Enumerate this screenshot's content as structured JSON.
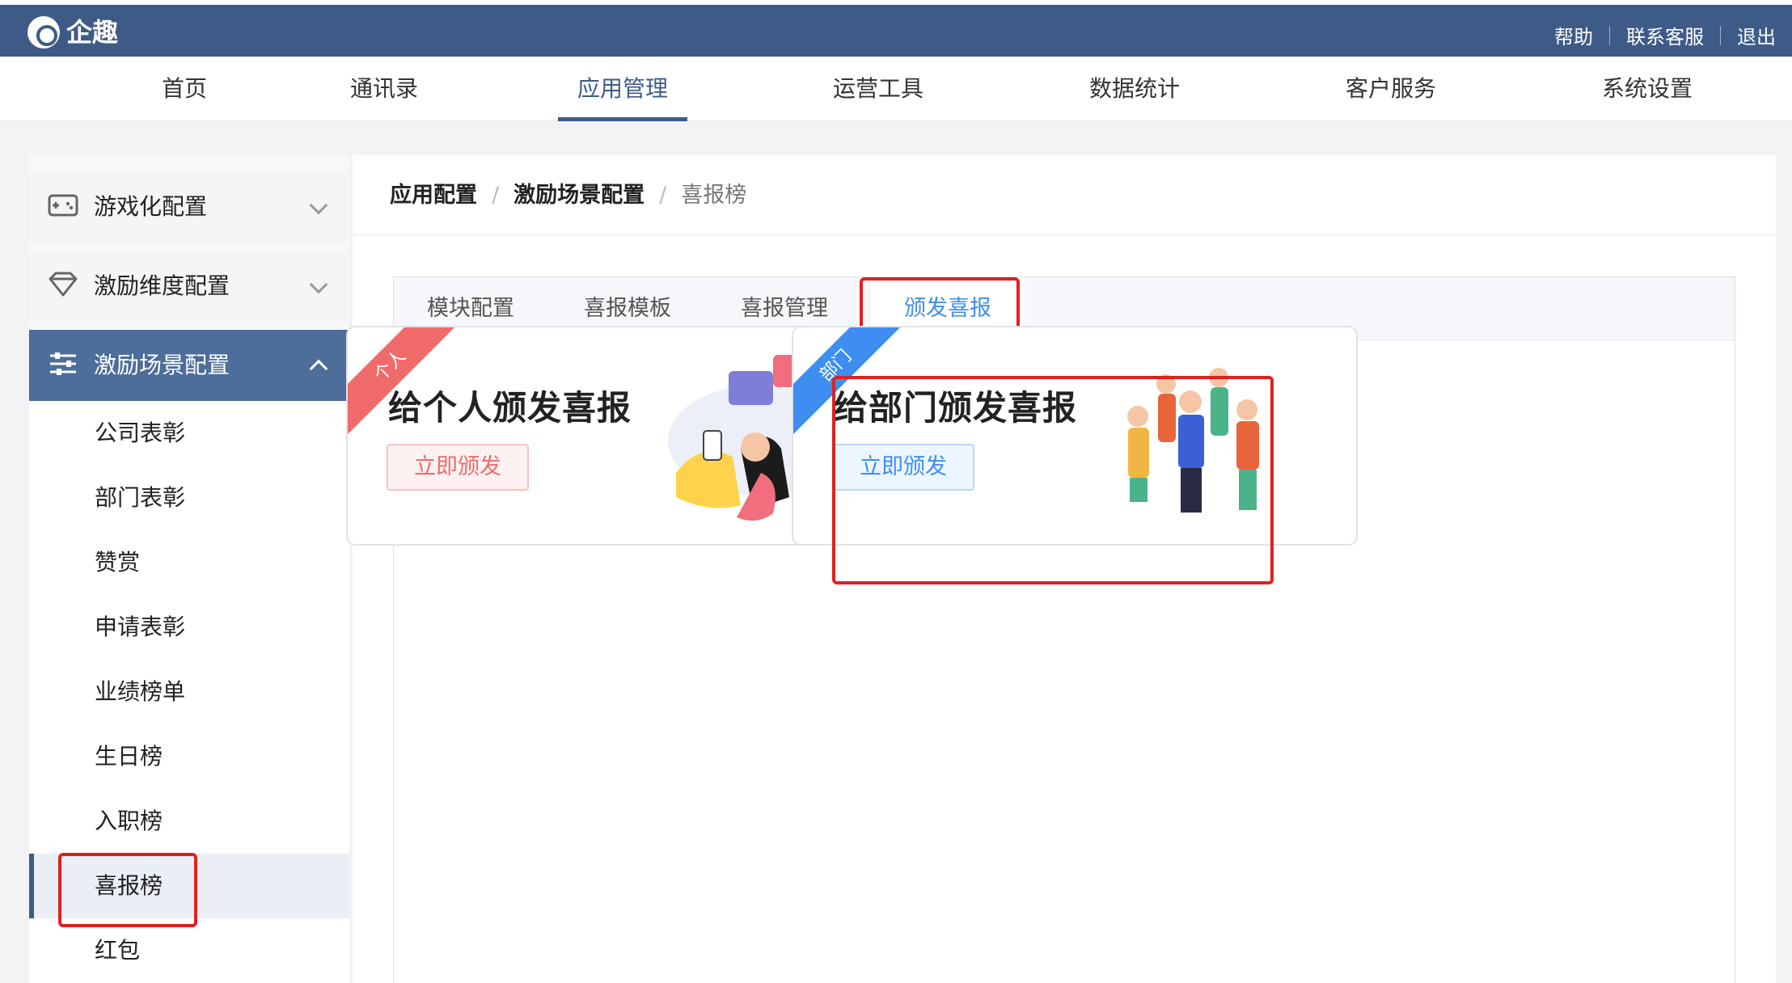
{
  "app": {
    "name": "企趣"
  },
  "top_links": [
    "帮助",
    "联系客服",
    "退出"
  ],
  "main_nav": {
    "items": [
      "首页",
      "通讯录",
      "应用管理",
      "运营工具",
      "数据统计",
      "客户服务",
      "系统设置"
    ],
    "active": "应用管理"
  },
  "sidebar": {
    "groups": [
      {
        "label": "游戏化配置",
        "icon": "gamepad-icon",
        "expanded": false
      },
      {
        "label": "激励维度配置",
        "icon": "diamond-icon",
        "expanded": false
      },
      {
        "label": "激励场景配置",
        "icon": "sliders-icon",
        "expanded": true
      }
    ],
    "sub_items": [
      "公司表彰",
      "部门表彰",
      "赞赏",
      "申请表彰",
      "业绩榜单",
      "生日榜",
      "入职榜",
      "喜报榜",
      "红包"
    ],
    "active_sub": "喜报榜"
  },
  "breadcrumb": [
    "应用配置",
    "激励场景配置",
    "喜报榜"
  ],
  "tabs": {
    "items": [
      "模块配置",
      "喜报模板",
      "喜报管理",
      "颁发喜报"
    ],
    "active": "颁发喜报"
  },
  "cards": [
    {
      "ribbon": "个人",
      "title": "给个人颁发喜报",
      "button": "立即颁发",
      "accent": "#f16a6a"
    },
    {
      "ribbon": "部门",
      "title": "给部门颁发喜报",
      "button": "立即颁发",
      "accent": "#3d8ef0"
    }
  ],
  "colors": {
    "header": "#3e5b87",
    "accent_blue": "#3d8ef0",
    "accent_red": "#f16a6a",
    "highlight": "#e02020"
  }
}
